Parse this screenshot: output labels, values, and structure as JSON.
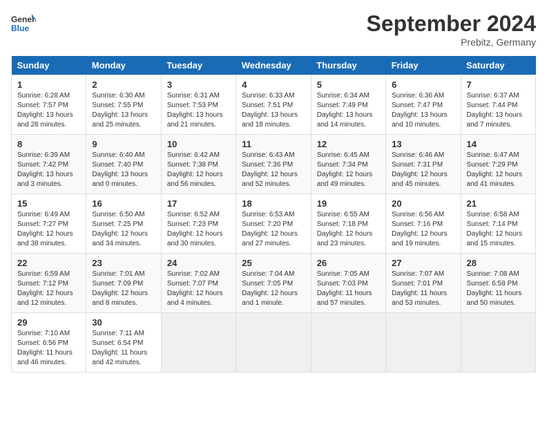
{
  "header": {
    "logo_line1": "General",
    "logo_line2": "Blue",
    "month_year": "September 2024",
    "location": "Prebitz, Germany"
  },
  "days_of_week": [
    "Sunday",
    "Monday",
    "Tuesday",
    "Wednesday",
    "Thursday",
    "Friday",
    "Saturday"
  ],
  "weeks": [
    [
      {
        "day": "1",
        "sunrise": "6:28 AM",
        "sunset": "7:57 PM",
        "daylight": "13 hours and 28 minutes."
      },
      {
        "day": "2",
        "sunrise": "6:30 AM",
        "sunset": "7:55 PM",
        "daylight": "13 hours and 25 minutes."
      },
      {
        "day": "3",
        "sunrise": "6:31 AM",
        "sunset": "7:53 PM",
        "daylight": "13 hours and 21 minutes."
      },
      {
        "day": "4",
        "sunrise": "6:33 AM",
        "sunset": "7:51 PM",
        "daylight": "13 hours and 18 minutes."
      },
      {
        "day": "5",
        "sunrise": "6:34 AM",
        "sunset": "7:49 PM",
        "daylight": "13 hours and 14 minutes."
      },
      {
        "day": "6",
        "sunrise": "6:36 AM",
        "sunset": "7:47 PM",
        "daylight": "13 hours and 10 minutes."
      },
      {
        "day": "7",
        "sunrise": "6:37 AM",
        "sunset": "7:44 PM",
        "daylight": "13 hours and 7 minutes."
      }
    ],
    [
      {
        "day": "8",
        "sunrise": "6:39 AM",
        "sunset": "7:42 PM",
        "daylight": "13 hours and 3 minutes."
      },
      {
        "day": "9",
        "sunrise": "6:40 AM",
        "sunset": "7:40 PM",
        "daylight": "13 hours and 0 minutes."
      },
      {
        "day": "10",
        "sunrise": "6:42 AM",
        "sunset": "7:38 PM",
        "daylight": "12 hours and 56 minutes."
      },
      {
        "day": "11",
        "sunrise": "6:43 AM",
        "sunset": "7:36 PM",
        "daylight": "12 hours and 52 minutes."
      },
      {
        "day": "12",
        "sunrise": "6:45 AM",
        "sunset": "7:34 PM",
        "daylight": "12 hours and 49 minutes."
      },
      {
        "day": "13",
        "sunrise": "6:46 AM",
        "sunset": "7:31 PM",
        "daylight": "12 hours and 45 minutes."
      },
      {
        "day": "14",
        "sunrise": "6:47 AM",
        "sunset": "7:29 PM",
        "daylight": "12 hours and 41 minutes."
      }
    ],
    [
      {
        "day": "15",
        "sunrise": "6:49 AM",
        "sunset": "7:27 PM",
        "daylight": "12 hours and 38 minutes."
      },
      {
        "day": "16",
        "sunrise": "6:50 AM",
        "sunset": "7:25 PM",
        "daylight": "12 hours and 34 minutes."
      },
      {
        "day": "17",
        "sunrise": "6:52 AM",
        "sunset": "7:23 PM",
        "daylight": "12 hours and 30 minutes."
      },
      {
        "day": "18",
        "sunrise": "6:53 AM",
        "sunset": "7:20 PM",
        "daylight": "12 hours and 27 minutes."
      },
      {
        "day": "19",
        "sunrise": "6:55 AM",
        "sunset": "7:18 PM",
        "daylight": "12 hours and 23 minutes."
      },
      {
        "day": "20",
        "sunrise": "6:56 AM",
        "sunset": "7:16 PM",
        "daylight": "12 hours and 19 minutes."
      },
      {
        "day": "21",
        "sunrise": "6:58 AM",
        "sunset": "7:14 PM",
        "daylight": "12 hours and 15 minutes."
      }
    ],
    [
      {
        "day": "22",
        "sunrise": "6:59 AM",
        "sunset": "7:12 PM",
        "daylight": "12 hours and 12 minutes."
      },
      {
        "day": "23",
        "sunrise": "7:01 AM",
        "sunset": "7:09 PM",
        "daylight": "12 hours and 8 minutes."
      },
      {
        "day": "24",
        "sunrise": "7:02 AM",
        "sunset": "7:07 PM",
        "daylight": "12 hours and 4 minutes."
      },
      {
        "day": "25",
        "sunrise": "7:04 AM",
        "sunset": "7:05 PM",
        "daylight": "12 hours and 1 minute."
      },
      {
        "day": "26",
        "sunrise": "7:05 AM",
        "sunset": "7:03 PM",
        "daylight": "11 hours and 57 minutes."
      },
      {
        "day": "27",
        "sunrise": "7:07 AM",
        "sunset": "7:01 PM",
        "daylight": "11 hours and 53 minutes."
      },
      {
        "day": "28",
        "sunrise": "7:08 AM",
        "sunset": "6:58 PM",
        "daylight": "11 hours and 50 minutes."
      }
    ],
    [
      {
        "day": "29",
        "sunrise": "7:10 AM",
        "sunset": "6:56 PM",
        "daylight": "11 hours and 46 minutes."
      },
      {
        "day": "30",
        "sunrise": "7:11 AM",
        "sunset": "6:54 PM",
        "daylight": "11 hours and 42 minutes."
      },
      null,
      null,
      null,
      null,
      null
    ]
  ]
}
